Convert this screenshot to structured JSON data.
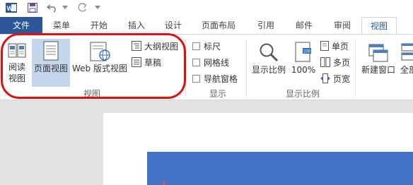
{
  "quick_access": {
    "app_icon": "word-app-icon",
    "save_icon": "save-icon",
    "undo_icon": "undo-icon",
    "redo_icon": "redo-icon",
    "dropdown_icon": "chevron-down-icon"
  },
  "tabs": {
    "file": "文件",
    "menu": "菜单",
    "start": "开始",
    "insert": "插入",
    "design": "设计",
    "page_layout": "页面布局",
    "reference": "引用",
    "mailings": "邮件",
    "review": "审阅",
    "view": "视图"
  },
  "ribbon": {
    "views_group": {
      "read_mode_l1": "阅读",
      "read_mode_l2": "视图",
      "print_layout": "页面视图",
      "web_layout": "Web 版式视图",
      "outline": "大纲视图",
      "draft": "草稿",
      "label": "视图"
    },
    "show_group": {
      "ruler": "标尺",
      "gridlines": "网格线",
      "nav_pane": "导航窗格",
      "label": "显示"
    },
    "zoom_group": {
      "zoom": "显示比例",
      "percent100": "100%",
      "one_page": "单页",
      "multi_page": "多页",
      "page_width": "页宽",
      "label": "显示比例"
    },
    "window_group": {
      "new_window": "新建窗口",
      "arrange_all": "全部"
    }
  },
  "colors": {
    "accent": "#2b579a",
    "selected": "#c5d7ef",
    "annotation": "#e01010",
    "doc_bg": "#e3e3e3",
    "content_block": "#4472c4"
  }
}
